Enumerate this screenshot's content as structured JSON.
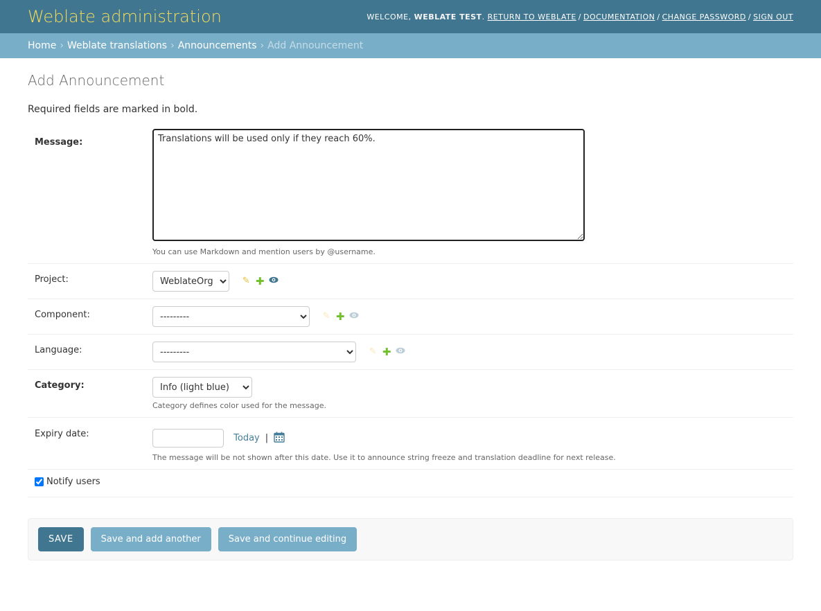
{
  "header": {
    "branding": "Weblate administration",
    "welcome_prefix": "Welcome,",
    "user_name": "Weblate Test",
    "links": [
      "Return to Weblate",
      "Documentation",
      "Change password",
      "Sign out"
    ]
  },
  "breadcrumbs": {
    "items": [
      "Home",
      "Weblate translations",
      "Announcements"
    ],
    "current": "Add Announcement"
  },
  "page": {
    "title": "Add Announcement",
    "required_note": "Required fields are marked in bold."
  },
  "form": {
    "message": {
      "label": "Message:",
      "value": "Translations will be used only if they reach 60%.",
      "help": "You can use Markdown and mention users by @username."
    },
    "project": {
      "label": "Project:",
      "selected": "WeblateOrg"
    },
    "component": {
      "label": "Component:",
      "selected": "---------"
    },
    "language": {
      "label": "Language:",
      "selected": "---------"
    },
    "category": {
      "label": "Category:",
      "selected": "Info (light blue)",
      "help": "Category defines color used for the message."
    },
    "expiry": {
      "label": "Expiry date:",
      "value": "",
      "today_link": "Today",
      "separator": "|",
      "help": "The message will be not shown after this date. Use it to announce string freeze and translation deadline for next release."
    },
    "notify": {
      "label": "Notify users",
      "checked": true
    }
  },
  "submit": {
    "save": "Save",
    "save_add_another": "Save and add another",
    "save_continue": "Save and continue editing"
  },
  "colors": {
    "header_bg": "#417690",
    "breadcrumb_bg": "#79aec8",
    "branding": "#f5dd5d"
  }
}
